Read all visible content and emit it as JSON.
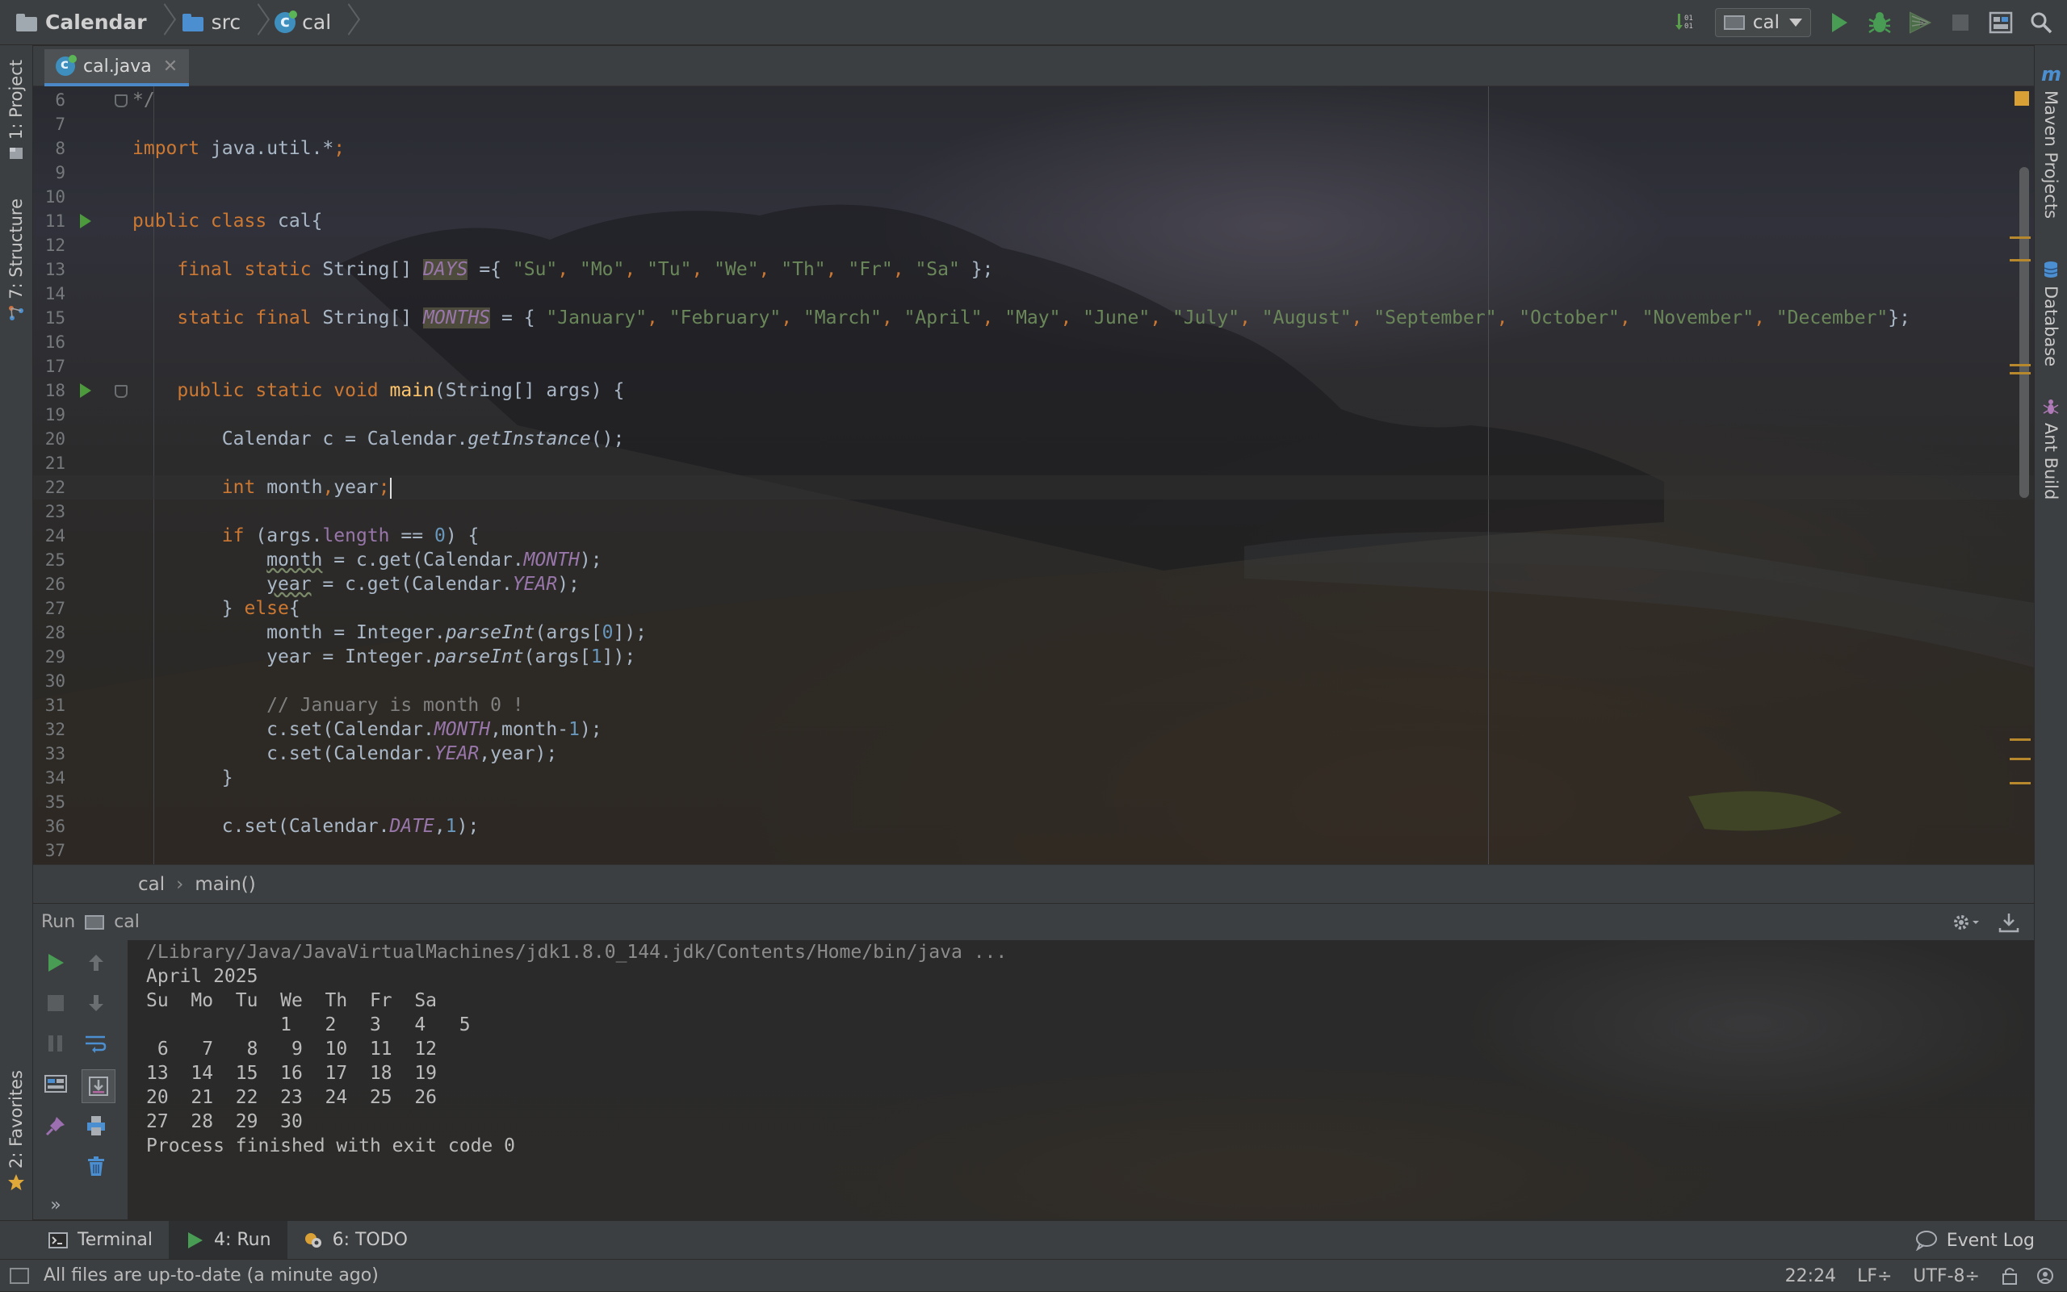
{
  "toolbar": {
    "breadcrumbs": [
      "Calendar",
      "src",
      "cal"
    ],
    "run_config": "cal"
  },
  "left_tabs": {
    "project": "1: Project",
    "structure": "7: Structure",
    "favorites": "2: Favorites"
  },
  "right_tabs": {
    "maven": "Maven Projects",
    "database": "Database",
    "ant": "Ant Build"
  },
  "editor": {
    "tab_label": "cal.java",
    "breadcrumb": [
      "cal",
      "main()"
    ],
    "line_numbers": [
      "6",
      "7",
      "8",
      "9",
      "10",
      "11",
      "12",
      "13",
      "14",
      "15",
      "16",
      "17",
      "18",
      "19",
      "20",
      "21",
      "22",
      "23",
      "24",
      "25",
      "26",
      "27",
      "28",
      "29",
      "30",
      "31",
      "32",
      "33",
      "34",
      "35",
      "36",
      "37"
    ],
    "code": {
      "l6": "*/",
      "l8_kw": "import",
      "l8_rest": "java.util.*",
      "l8_end": ";",
      "l11_kw": "public class",
      "l11_rest": "cal{",
      "l13_kw": "final static",
      "l13_type": "String[]",
      "l13_name": "DAYS",
      "l13_eq": "={",
      "l13_days": [
        "\"Su\"",
        "\"Mo\"",
        "\"Tu\"",
        "\"We\"",
        "\"Th\"",
        "\"Fr\"",
        "\"Sa\""
      ],
      "l13_end": "};",
      "l15_kw": "static final",
      "l15_type": "String[]",
      "l15_name": "MONTHS",
      "l15_eq": "= {",
      "l15_months": [
        "\"January\"",
        "\"February\"",
        "\"March\"",
        "\"April\"",
        "\"May\"",
        "\"June\"",
        "\"July\"",
        "\"August\"",
        "\"September\"",
        "\"October\"",
        "\"November\"",
        "\"December\""
      ],
      "l15_end": "};",
      "l18_kw": "public static void",
      "l18_fn": "main",
      "l18_rest": "(String[] args) {",
      "l20_a": "Calendar c = Calendar.",
      "l20_m": "getInstance",
      "l20_b": "();",
      "l22_kw": "int",
      "l22_rest": "month",
      "l22_c": ",",
      "l22_rest2": "year",
      "l22_end": ";",
      "l24_kw": "if",
      "l24_a": "(args.",
      "l24_f": "length",
      "l24_b": "==",
      "l24_n": "0",
      "l24_c": ") {",
      "l25_a": "month",
      "l25_b": " = c.get(Calendar.",
      "l25_f": "MONTH",
      "l25_c": ");",
      "l26_a": "year",
      "l26_b": " = c.get(Calendar.",
      "l26_f": "YEAR",
      "l26_c": ");",
      "l27_a": "} ",
      "l27_kw": "else",
      "l27_b": "{",
      "l28_a": "month = Integer.",
      "l28_m": "parseInt",
      "l28_b": "(args[",
      "l28_n": "0",
      "l28_c": "]);",
      "l29_a": "year = Integer.",
      "l29_m": "parseInt",
      "l29_b": "(args[",
      "l29_n": "1",
      "l29_c": "]);",
      "l31": "// January is month 0 !",
      "l32_a": "c.set(Calendar.",
      "l32_f": "MONTH",
      "l32_b": ",month-",
      "l32_n": "1",
      "l32_c": ");",
      "l33_a": "c.set(Calendar.",
      "l33_f": "YEAR",
      "l33_b": ",year);",
      "l34": "}",
      "l36_a": "c.set(Calendar.",
      "l36_f": "DATE",
      "l36_b": ",",
      "l36_n": "1",
      "l36_c": ");"
    }
  },
  "run_panel": {
    "title": "Run",
    "config": "cal",
    "output": [
      "/Library/Java/JavaVirtualMachines/jdk1.8.0_144.jdk/Contents/Home/bin/java ...",
      "April 2025",
      "Su  Mo  Tu  We  Th  Fr  Sa",
      "            1   2   3   4   5",
      " 6   7   8   9  10  11  12",
      "13  14  15  16  17  18  19",
      "20  21  22  23  24  25  26",
      "27  28  29  30",
      "Process finished with exit code 0"
    ]
  },
  "bottom_tabs": {
    "terminal": "Terminal",
    "run": "4: Run",
    "todo": "6: TODO",
    "event_log": "Event Log"
  },
  "status_bar": {
    "message": "All files are up-to-date (a minute ago)",
    "position": "22:24",
    "line_sep": "LF÷",
    "encoding": "UTF-8÷"
  },
  "colors": {
    "keyword": "#cc7832",
    "string": "#6a8759",
    "number": "#6897bb",
    "field": "#9876aa",
    "method": "#ffc66d",
    "comment": "#808080",
    "run_green": "#4c9a3b"
  }
}
